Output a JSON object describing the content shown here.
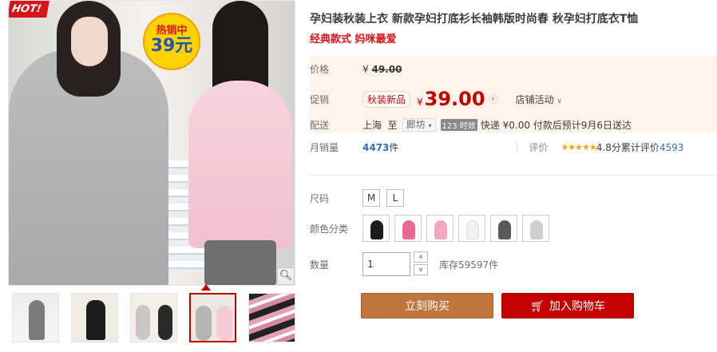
{
  "gallery": {
    "hot_label": "HOT!",
    "badge_top": "热销中",
    "badge_price": "39元",
    "zoom_icon": "magnifier-icon",
    "thumb_count": 5,
    "active_thumb": 4
  },
  "product": {
    "title": "孕妇装秋装上衣 新款孕妇打底衫长袖韩版时尚春 秋孕妇打底衣T恤",
    "subtitle": "经典款式 妈咪最爱"
  },
  "price": {
    "orig_label": "价格",
    "currency": "¥",
    "orig_value": "49.00",
    "promo_label": "促销",
    "promo_tag": "秋装新品",
    "promo_value": "39.00",
    "shop_activity": "店铺活动"
  },
  "delivery": {
    "label": "配送",
    "from": "上海",
    "to_word": "至",
    "to_city": "廊坊",
    "time_tag": "123 时效",
    "express": "快递 ¥0.00 付款后预计9月6日送达"
  },
  "sales": {
    "label": "月销量",
    "count": "4473",
    "unit": "件",
    "rating_label": "评价",
    "stars": "★★★★★",
    "score": "4.8分",
    "review_text": "累计评价",
    "review_count": "4593"
  },
  "options": {
    "size_label": "尺码",
    "sizes": [
      "M",
      "L"
    ],
    "color_label": "颜色分类",
    "colors": [
      "#1c1c1c",
      "#e86a94",
      "#f4a7bf",
      "#f2f2f2",
      "#5a5a5a",
      "#cfcfcf"
    ]
  },
  "quantity": {
    "label": "数量",
    "value": "1",
    "stock": "库存59597件"
  },
  "actions": {
    "buy_now": "立刻购买",
    "add_cart": "加入购物车"
  }
}
